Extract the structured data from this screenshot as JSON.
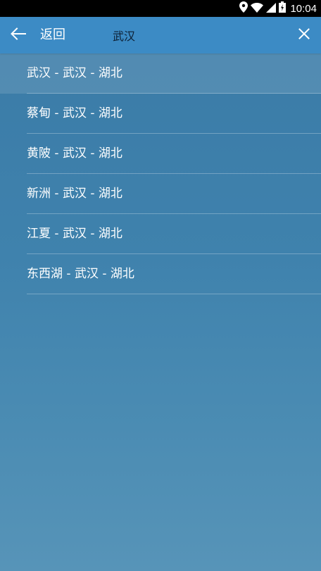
{
  "status_bar": {
    "time": "10:04",
    "icons": [
      "location-icon",
      "wifi-icon",
      "signal-icon",
      "battery-icon"
    ]
  },
  "toolbar": {
    "back_icon": "arrow-left-icon",
    "back_label": "返回",
    "search_value": "武汉",
    "clear_icon": "close-icon"
  },
  "results": [
    {
      "text": "武汉 - 武汉 - 湖北",
      "selected": true
    },
    {
      "text": "蔡甸 - 武汉 - 湖北",
      "selected": false
    },
    {
      "text": "黄陂 - 武汉 - 湖北",
      "selected": false
    },
    {
      "text": "新洲 - 武汉 - 湖北",
      "selected": false
    },
    {
      "text": "江夏 - 武汉 - 湖北",
      "selected": false
    },
    {
      "text": "东西湖 - 武汉 - 湖北",
      "selected": false
    }
  ],
  "colors": {
    "toolbar": "#3c8bc5",
    "background_top": "#3a7aa6",
    "background_bottom": "#5794b8",
    "text": "#ffffff"
  }
}
